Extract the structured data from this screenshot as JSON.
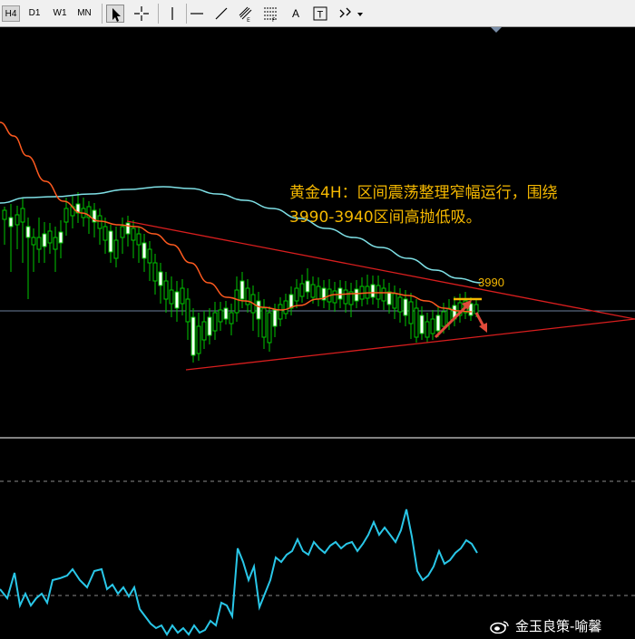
{
  "toolbar": {
    "timeframes": [
      "H4",
      "D1",
      "W1",
      "MN"
    ],
    "text_tool_label": "A",
    "text_label_tool_label": "T"
  },
  "chart": {
    "annotation_line1": "黄金4H：区间震荡整理窄幅运行，围绕",
    "annotation_line2": "3990-3940区间高抛低吸。",
    "price_label": "3990",
    "colors": {
      "background": "#000000",
      "ma_fast": "#ff5a1f",
      "ma_slow": "#7fe0e6",
      "candle_bull": "#00c800",
      "trendline": "#d81e1e",
      "horizontal_line": "#7a8ea8",
      "arrow": "#e04a3a",
      "level_marker": "#f5b800",
      "oscillator": "#29c7e8"
    }
  },
  "watermark": {
    "text": "金玉良策-喻馨",
    "icon": "weibo-icon"
  }
}
